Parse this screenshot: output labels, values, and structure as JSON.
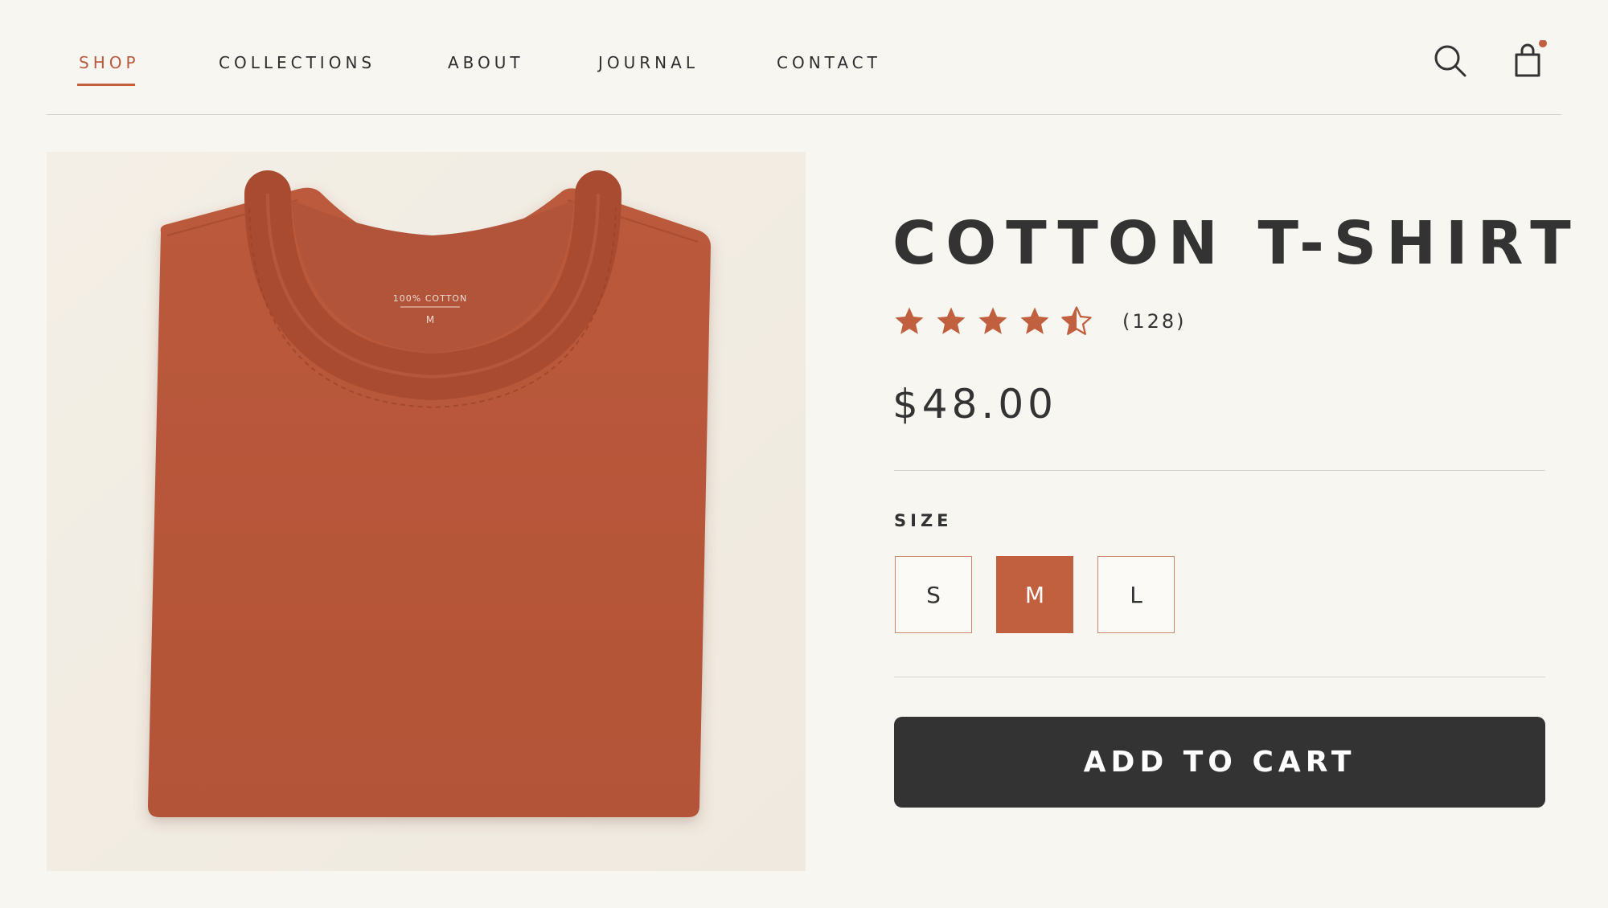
{
  "nav": {
    "items": [
      {
        "label": "SHOP",
        "active": true
      },
      {
        "label": "COLLECTIONS",
        "active": false
      },
      {
        "label": "ABOUT",
        "active": false
      },
      {
        "label": "JOURNAL",
        "active": false
      },
      {
        "label": "CONTACT",
        "active": false
      }
    ],
    "icons": [
      "search-icon",
      "shopping-bag-icon"
    ],
    "cart_has_items": true
  },
  "product": {
    "title": "COTTON T-SHIRT",
    "rating": 4.5,
    "rating_max": 5,
    "review_count": "(128)",
    "price": "$48.00",
    "image": {
      "label_text": "100% COTTON",
      "label_size": "M"
    },
    "size_label": "SIZE",
    "sizes": [
      {
        "label": "S",
        "selected": false
      },
      {
        "label": "M",
        "selected": true
      },
      {
        "label": "L",
        "selected": false
      }
    ],
    "add_to_cart_label": "ADD TO CART"
  },
  "colors": {
    "accent": "#c0603f",
    "background": "#f8f6f1",
    "dark": "#333333",
    "shirt": "#b95639"
  }
}
